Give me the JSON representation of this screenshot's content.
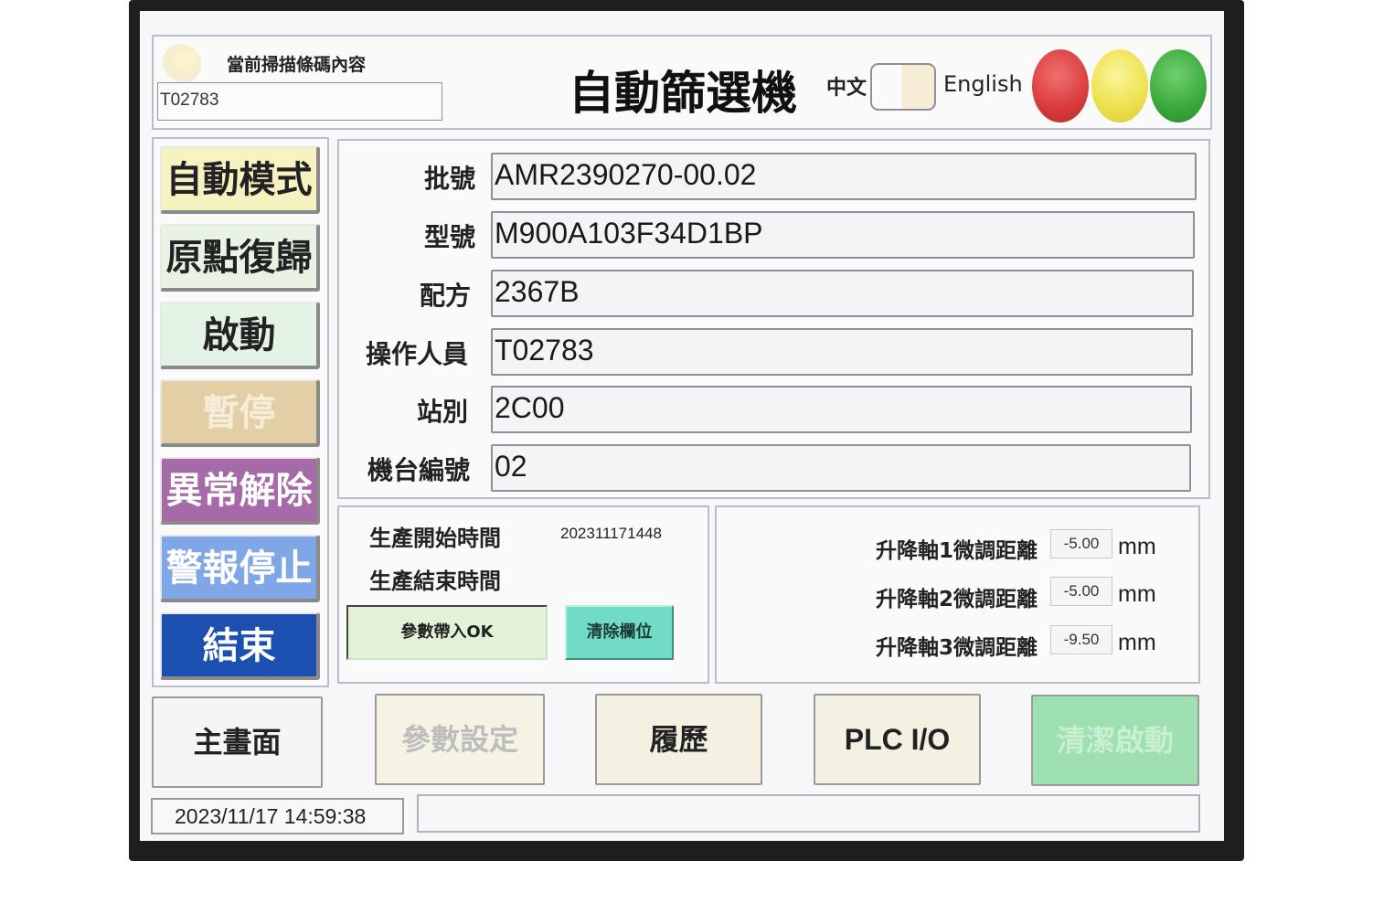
{
  "header": {
    "scan_label": "當前掃描條碼內容",
    "scan_value": "T02783",
    "title": "自動篩選機",
    "lang_zh": "中文",
    "lang_en": "English"
  },
  "lights": {
    "red": "#d83a3a",
    "yellow": "#ece04a",
    "green": "#3aa83a"
  },
  "sidebar": {
    "auto_mode": "自動模式",
    "home_return": "原點復歸",
    "start": "啟動",
    "pause": "暫停",
    "clear_error": "異常解除",
    "alarm_stop": "警報停止",
    "end": "結束"
  },
  "info": {
    "batch": {
      "label": "批號",
      "value": "AMR2390270-00.02"
    },
    "model": {
      "label": "型號",
      "value": "M900A103F34D1BP"
    },
    "recipe": {
      "label": "配方",
      "value": "2367B"
    },
    "operator": {
      "label": "操作人員",
      "value": "T02783"
    },
    "station": {
      "label": "站別",
      "value": "2C00"
    },
    "machine_no": {
      "label": "機台編號",
      "value": "02"
    }
  },
  "production": {
    "start_label": "生產開始時間",
    "start_value": "202311171448",
    "end_label": "生產結束時間",
    "end_value": "",
    "apply_params_button": "參數帶入OK",
    "clear_fields_button": "清除欄位"
  },
  "axes": [
    {
      "label": "升降軸1微調距離",
      "value": "-5.00",
      "unit": "mm"
    },
    {
      "label": "升降軸2微調距離",
      "value": "-5.00",
      "unit": "mm"
    },
    {
      "label": "升降軸3微調距離",
      "value": "-9.50",
      "unit": "mm"
    }
  ],
  "nav": {
    "main": "主畫面",
    "params": "參數設定",
    "history": "履歷",
    "plc": "PLC I/O",
    "cleaning": "清潔啟動"
  },
  "footer": {
    "datetime": "2023/11/17 14:59:38",
    "message": ""
  }
}
